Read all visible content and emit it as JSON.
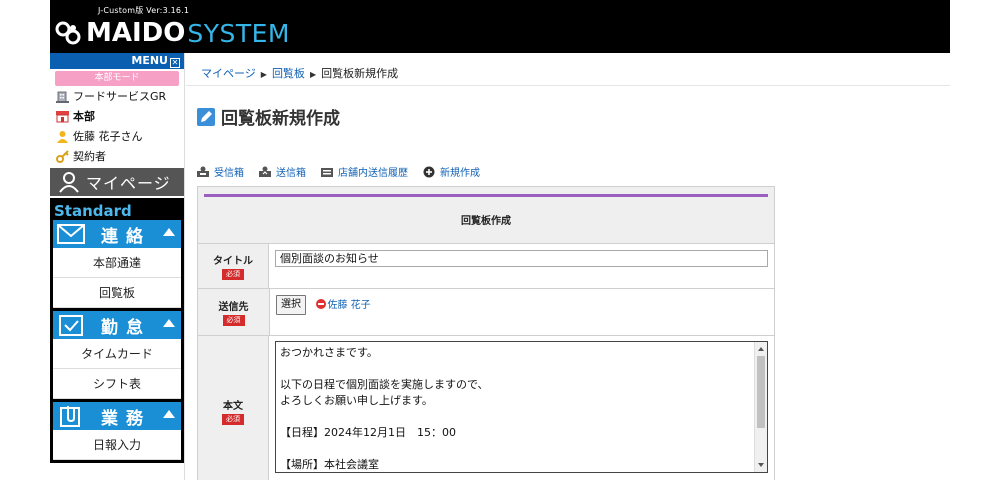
{
  "header": {
    "version": "J-Custom版 Ver:3.16.1",
    "logo_main": "MAIDO",
    "logo_sub": "SYSTEM"
  },
  "sidebar": {
    "menu_label": "MENU",
    "menu_close_glyph": "✕",
    "mode_badge": "本部モード",
    "info": [
      {
        "icon": "building-icon",
        "text": "フードサービスGR"
      },
      {
        "icon": "store-icon",
        "text": "本部"
      },
      {
        "icon": "person-icon",
        "text": "佐藤 花子さん"
      },
      {
        "icon": "key-icon",
        "text": "契約者"
      }
    ],
    "mypage_label": "マイページ",
    "standard_label": "Standard",
    "sections": [
      {
        "title": "連絡",
        "icon": "envelope-icon",
        "items": [
          "本部通達",
          "回覧板"
        ]
      },
      {
        "title": "勤怠",
        "icon": "calendar-icon",
        "items": [
          "タイムカード",
          "シフト表"
        ]
      },
      {
        "title": "業務",
        "icon": "clip-icon",
        "items": [
          "日報入力"
        ]
      }
    ]
  },
  "breadcrumb": {
    "items": [
      "マイページ",
      "回覧板",
      "回覧板新規作成"
    ],
    "separator": "▶"
  },
  "page_title": "回覧板新規作成",
  "toolbar": [
    "受信箱",
    "送信箱",
    "店舗内送信履歴",
    "新規作成"
  ],
  "form": {
    "heading": "回覧板作成",
    "required_label": "必須",
    "title_label": "タイトル",
    "title_value": "個別面談のお知らせ",
    "recipient_label": "送信先",
    "select_button": "選択",
    "recipient_name": "佐藤 花子",
    "body_label": "本文",
    "body_lines": [
      "おつかれさまです。",
      "",
      "以下の日程で個別面談を実施しますので、",
      "よろしくお願い申し上げます。",
      "",
      "【日程】2024年12月1日　15：00",
      "",
      "【場所】本社会議室"
    ]
  },
  "colors": {
    "header_bg": "#000000",
    "logo_accent": "#35b6e8",
    "menu_bar": "#0a5fb0",
    "mode_badge": "#f7a0c6",
    "section_head": "#1a8fd6",
    "link": "#1162b5",
    "form_accent": "#9a5ec0",
    "required": "#d42c2c"
  }
}
